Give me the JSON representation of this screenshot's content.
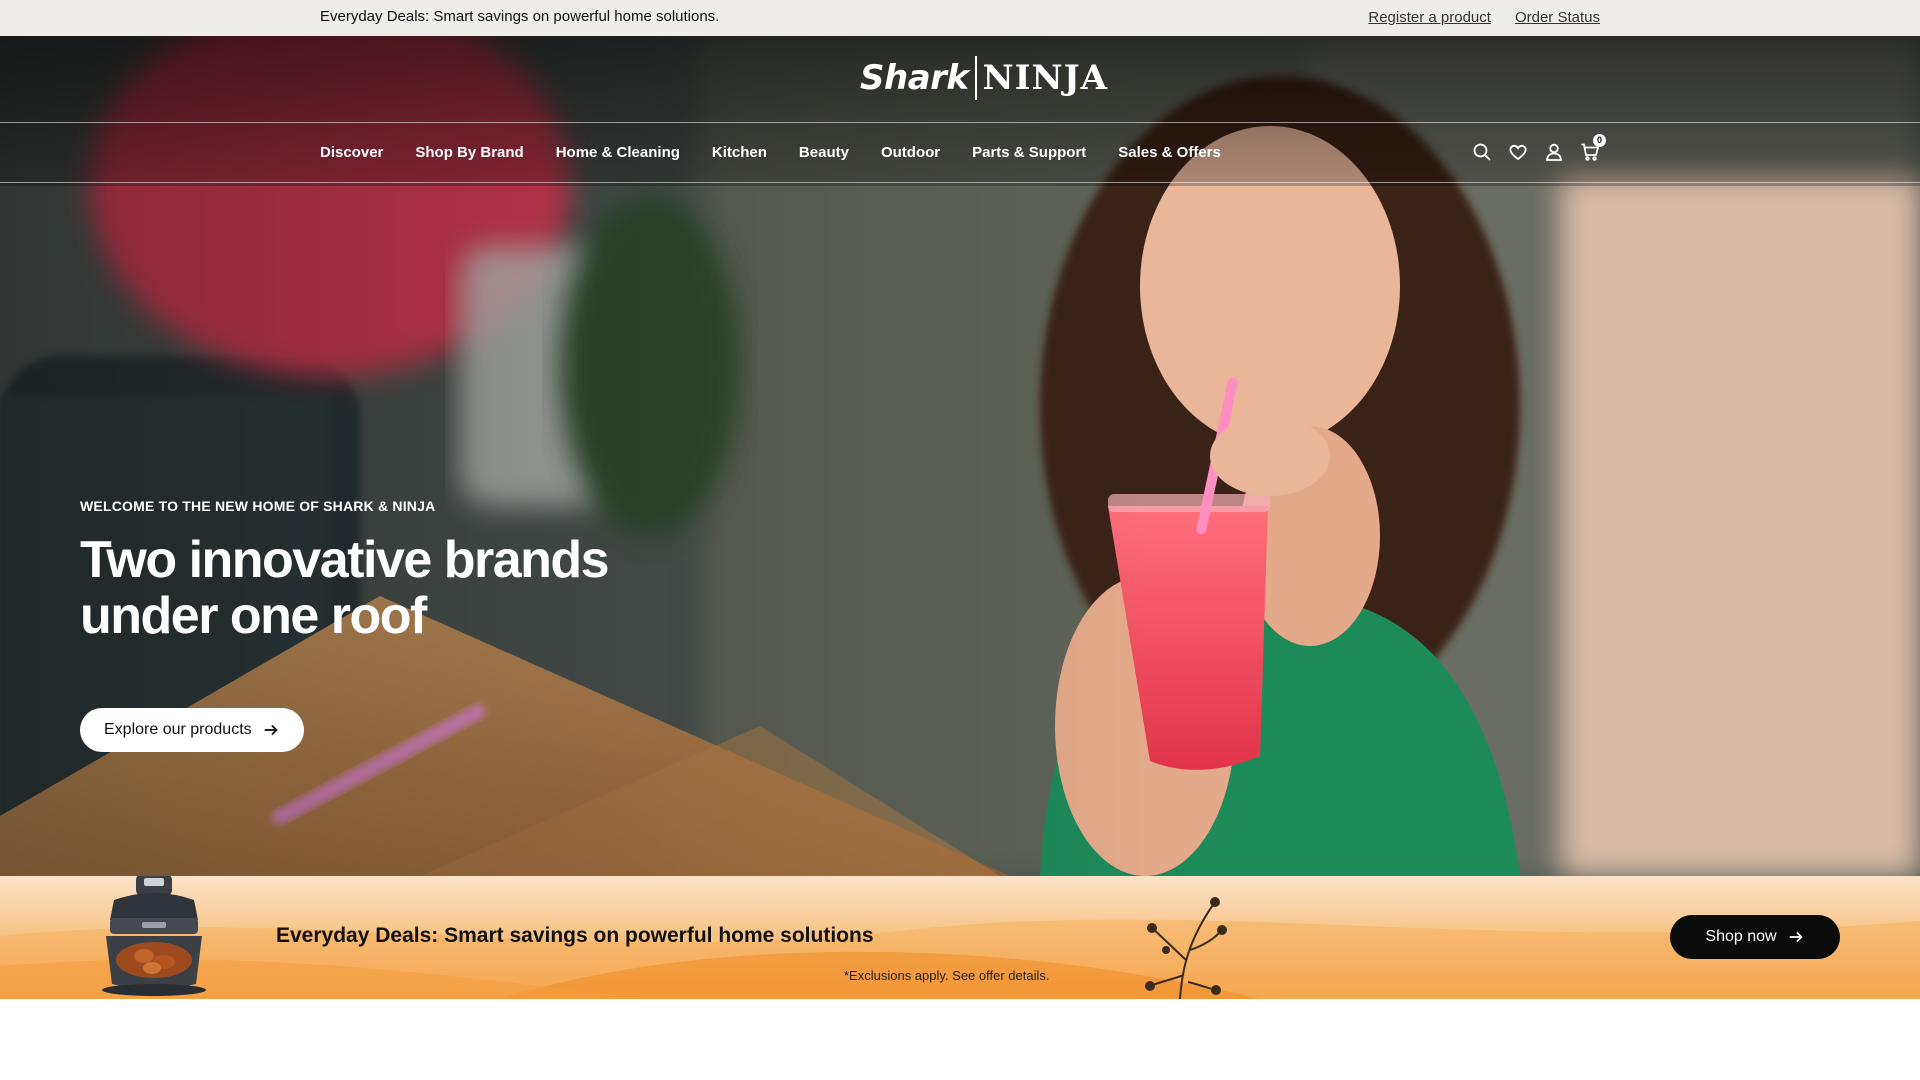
{
  "announcement": {
    "message": "Everyday Deals: Smart savings on powerful home solutions.",
    "links": [
      "Register a product",
      "Order Status"
    ]
  },
  "brand": {
    "logo_left": "Shark",
    "logo_right": "NINJA"
  },
  "nav": {
    "items": [
      "Discover",
      "Shop By Brand",
      "Home & Cleaning",
      "Kitchen",
      "Beauty",
      "Outdoor",
      "Parts & Support",
      "Sales & Offers"
    ]
  },
  "header_icons": {
    "search": "search-icon",
    "wishlist": "heart-icon",
    "account": "user-icon",
    "cart": "cart-icon",
    "cart_count": "0"
  },
  "hero": {
    "eyebrow": "WELCOME TO THE NEW HOME OF SHARK & NINJA",
    "headline_line1": "Two innovative brands",
    "headline_line2": "under one roof",
    "cta_label": "Explore our products"
  },
  "deals_banner": {
    "title": "Everyday Deals: Smart savings on powerful home solutions",
    "fine_print": "*Exclusions apply. See offer details.",
    "cta_label": "Shop now"
  },
  "colors": {
    "topbar_bg": "#efedea",
    "deals_gradient_top": "#fbe3c9",
    "deals_gradient_bottom": "#f39a3c",
    "button_dark": "#0b0b0b",
    "button_light": "#ffffff"
  }
}
